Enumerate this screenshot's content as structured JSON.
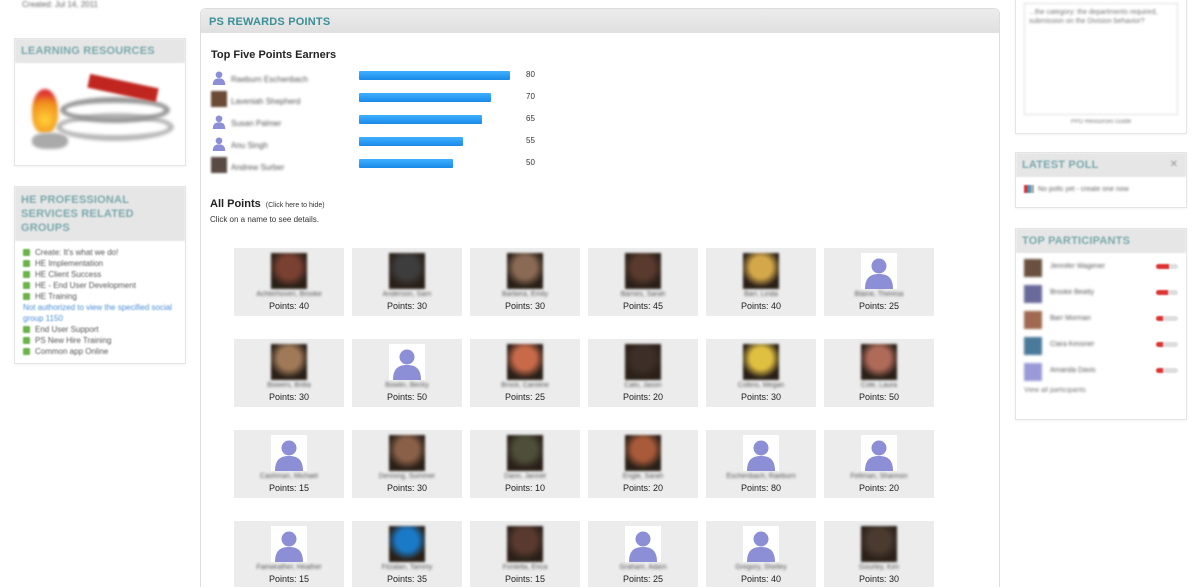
{
  "sidebar_left": {
    "created_text": "Created: Jul 14, 2011",
    "learning": {
      "title": "LEARNING RESOURCES"
    },
    "groups": {
      "title": "HE PROFESSIONAL SERVICES RELATED GROUPS",
      "items": [
        "Create: It's what we do!",
        "HE Implementation",
        "HE Client Success",
        "HE - End User Development",
        "HE Training",
        "Not authorized to view the specified social group 1150",
        "End User Support",
        "PS New Hire Training",
        "Common app Online"
      ]
    }
  },
  "main": {
    "header": "PS REWARDS POINTS",
    "top_title": "Top Five Points Earners",
    "top_earners": [
      {
        "name": "Raeburn Eschenbach",
        "points": 80,
        "avatar": "generic"
      },
      {
        "name": "Laveniah Shepherd",
        "points": 70,
        "avatar": "photo",
        "color": "#6b4a36"
      },
      {
        "name": "Susan Palmer",
        "points": 65,
        "avatar": "generic"
      },
      {
        "name": "Anu Singh",
        "points": 55,
        "avatar": "generic"
      },
      {
        "name": "Andrew Surber",
        "points": 50,
        "avatar": "photo",
        "color": "#5a4a44"
      }
    ],
    "all_title": "All Points",
    "hide_link": "(Click here to hide)",
    "instructions": "Click on a name to see details.",
    "cards": [
      {
        "name": "Achterhoven, Brooke",
        "points": "Points: 40",
        "avatar": "photo",
        "color": "#7a4032"
      },
      {
        "name": "Anderson, Sarri",
        "points": "Points: 30",
        "avatar": "photo",
        "color": "#3d3d3d"
      },
      {
        "name": "Barbera, Emily",
        "points": "Points: 30",
        "avatar": "photo",
        "color": "#8a6a55"
      },
      {
        "name": "Barnes, Sarah",
        "points": "Points: 45",
        "avatar": "photo",
        "color": "#5a3a2e"
      },
      {
        "name": "Barr, Linda",
        "points": "Points: 40",
        "avatar": "photo",
        "color": "#d4a84a"
      },
      {
        "name": "Blaine, Theresa",
        "points": "Points: 25",
        "avatar": "generic"
      },
      {
        "name": "Bowers, Britta",
        "points": "Points: 30",
        "avatar": "photo",
        "color": "#a07a58"
      },
      {
        "name": "Bowlin, Becky",
        "points": "Points: 50",
        "avatar": "generic"
      },
      {
        "name": "Brock, Caroline",
        "points": "Points: 25",
        "avatar": "photo",
        "color": "#c86a4a"
      },
      {
        "name": "Cato, Jason",
        "points": "Points: 20",
        "avatar": "photo",
        "color": "#3d2e28"
      },
      {
        "name": "Collins, Megan",
        "points": "Points: 30",
        "avatar": "photo",
        "color": "#e0c040"
      },
      {
        "name": "Cole, Laura",
        "points": "Points: 50",
        "avatar": "photo",
        "color": "#b06a5a"
      },
      {
        "name": "Cashman, Michael",
        "points": "Points: 15",
        "avatar": "generic"
      },
      {
        "name": "Denning, Summer",
        "points": "Points: 30",
        "avatar": "photo",
        "color": "#8a6048"
      },
      {
        "name": "Dann, Jannet",
        "points": "Points: 10",
        "avatar": "photo",
        "color": "#4e4e3a"
      },
      {
        "name": "Engle, Sarah",
        "points": "Points: 20",
        "avatar": "photo",
        "color": "#a85a3a"
      },
      {
        "name": "Eschenbach, Raeburn",
        "points": "Points: 80",
        "avatar": "generic"
      },
      {
        "name": "Feltman, Shannon",
        "points": "Points: 20",
        "avatar": "generic"
      },
      {
        "name": "Fairweather, Heather",
        "points": "Points: 15",
        "avatar": "generic"
      },
      {
        "name": "Fitzalan, Tammy",
        "points": "Points: 35",
        "avatar": "photo",
        "color": "#1a7ac8"
      },
      {
        "name": "Fontella, Erica",
        "points": "Points: 15",
        "avatar": "photo",
        "color": "#5a3a30"
      },
      {
        "name": "Graham, Adam",
        "points": "Points: 25",
        "avatar": "generic"
      },
      {
        "name": "Gregory, Shelley",
        "points": "Points: 40",
        "avatar": "generic"
      },
      {
        "name": "Gourley, Kim",
        "points": "Points: 30",
        "avatar": "photo",
        "color": "#4a3a30"
      }
    ]
  },
  "sidebar_right": {
    "textarea_text": "...the category: the departments required, submission on the Division behavior?",
    "textarea_caption": "PPD Resources Guide",
    "poll": {
      "title": "LATEST POLL",
      "text": "No polls yet - create one now"
    },
    "participants": {
      "title": "TOP PARTICIPANTS",
      "items": [
        {
          "name": "Jennifer Wagener",
          "level": 0.6,
          "color": "#6a5040"
        },
        {
          "name": "Brooke Beatty",
          "level": 0.55,
          "color": "#6a6a9a"
        },
        {
          "name": "Barr Morman",
          "level": 0.3,
          "color": "#a06a50"
        },
        {
          "name": "Clara Kessner",
          "level": 0.3,
          "color": "#4a7a9a"
        },
        {
          "name": "Amanda Davis",
          "level": 0.3,
          "color": "#9a9ad8"
        }
      ],
      "view_all": "View all participants"
    }
  }
}
